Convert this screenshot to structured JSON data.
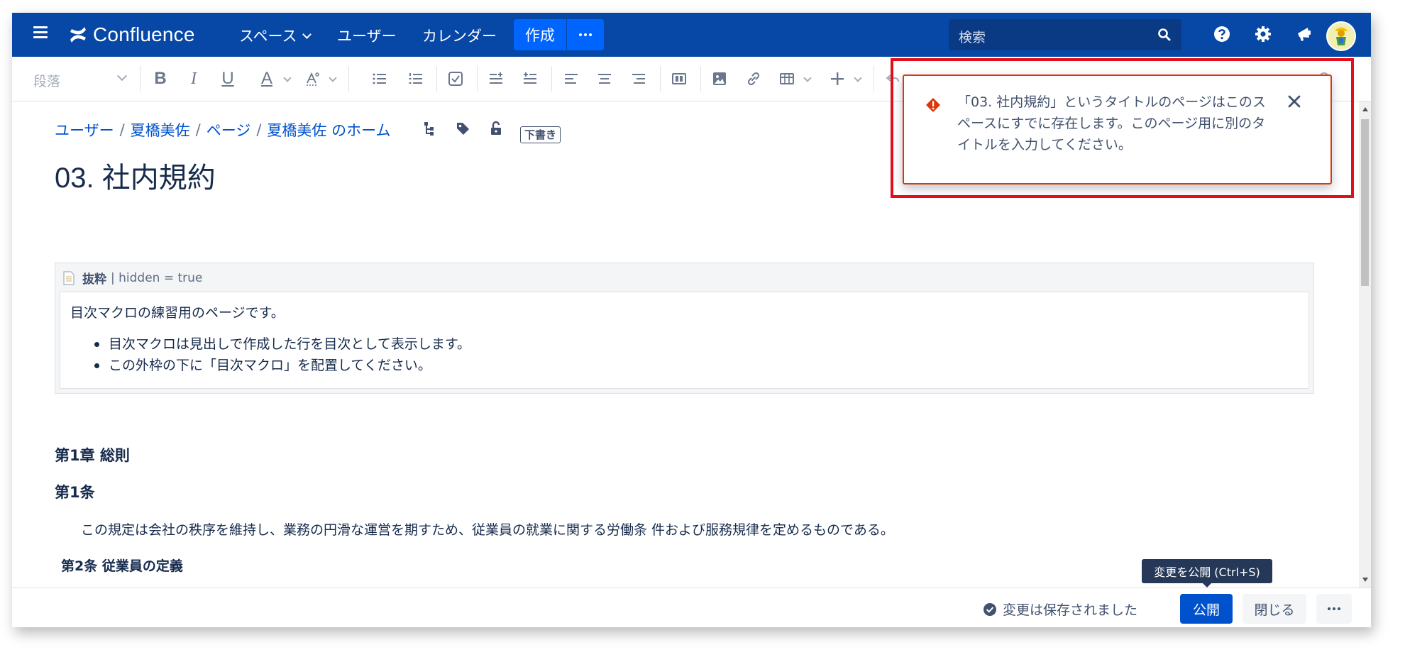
{
  "nav": {
    "logo": "Confluence",
    "spaces": "スペース",
    "users": "ユーザー",
    "calendar": "カレンダー",
    "create": "作成",
    "search_placeholder": "検索"
  },
  "toolbar": {
    "paragraph_style": "段落"
  },
  "breadcrumb": {
    "items": [
      "ユーザー",
      "夏橋美佐",
      "ページ",
      "夏橋美佐 のホーム"
    ],
    "draft_badge": "下書き"
  },
  "page": {
    "title": "03. 社内規約",
    "excerpt": {
      "name": "抜粋",
      "params": "| hidden = true",
      "intro": "目次マクロの練習用のページです。",
      "bullets": [
        "目次マクロは見出しで作成した行を目次として表示します。",
        "この外枠の下に「目次マクロ」を配置してください。"
      ]
    },
    "chapter1": "第1章 総則",
    "article1_heading": "第1条",
    "article1_text": "この規定は会社の秩序を維持し、業務の円滑な運営を期すため、従業員の就業に関する労働条 件および服務規律を定めるものである。",
    "article2_heading": "第2条 従業員の定義"
  },
  "footer": {
    "saved_status": "変更は保存されました",
    "publish": "公開",
    "close": "閉じる",
    "publish_tooltip": "変更を公開 (Ctrl+S)"
  },
  "error_flag": {
    "message": "「03. 社内規約」というタイトルのページはこのスペースにすでに存在します。このページ用に別のタイトルを入力してください。"
  },
  "colors": {
    "nav_bg": "#0747a6",
    "primary": "#0052cc",
    "error": "#de350b",
    "highlight": "#e0101a"
  }
}
